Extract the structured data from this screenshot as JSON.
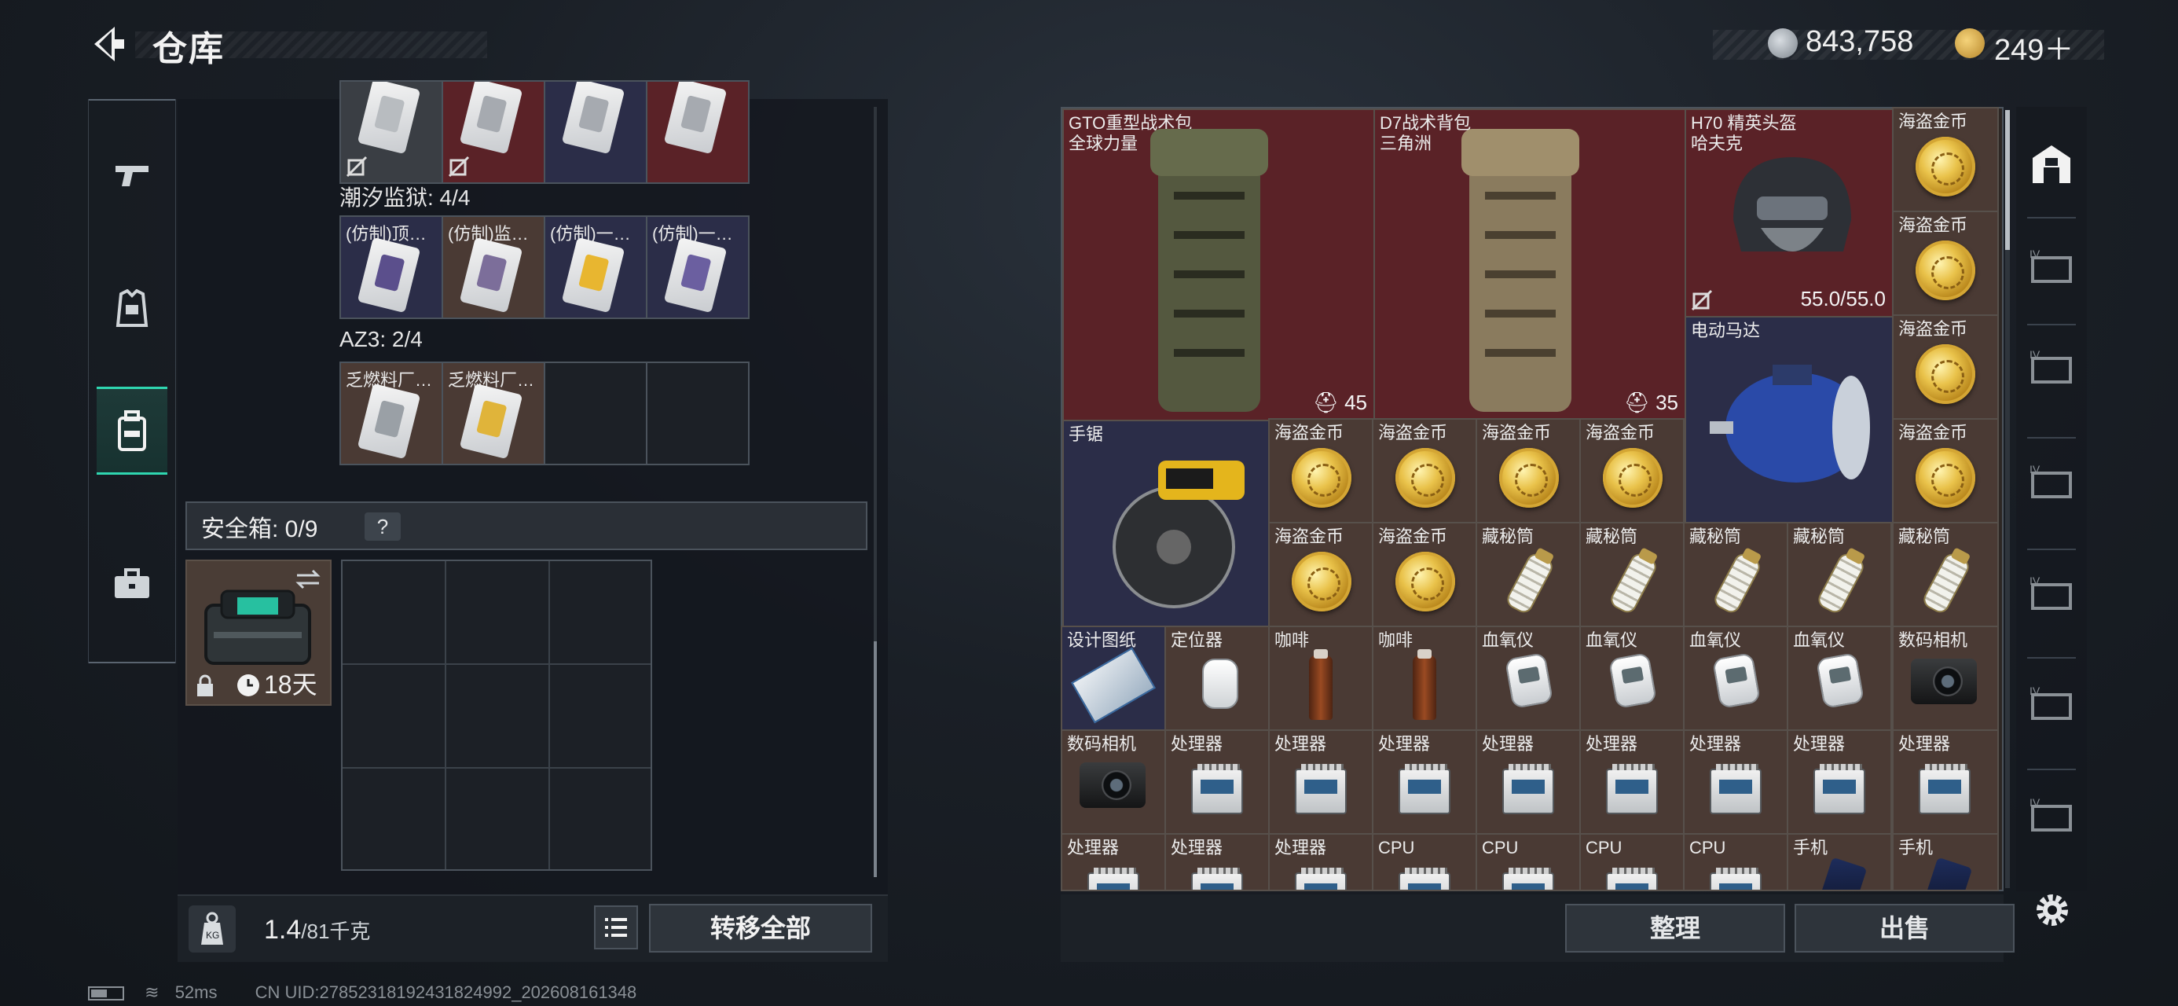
{
  "header": {
    "title": "仓库",
    "currency": [
      {
        "icon": "silver-coin-icon",
        "value": "843,758"
      },
      {
        "icon": "gold-triangle-coin-icon",
        "value": "249＋"
      }
    ]
  },
  "categories": [
    {
      "name": "weapons",
      "icon": "gun-icon"
    },
    {
      "name": "armor",
      "icon": "vest-icon"
    },
    {
      "name": "backpack",
      "icon": "backpack-icon",
      "active": true
    },
    {
      "name": "briefcase",
      "icon": "briefcase-icon"
    }
  ],
  "left": {
    "groups": [
      {
        "title": "",
        "cells": [
          {
            "label": "",
            "color": "gray",
            "locked": true
          },
          {
            "label": "",
            "color": "red",
            "locked": true
          },
          {
            "label": "",
            "color": "blue"
          },
          {
            "label": "",
            "color": "red"
          }
        ]
      },
      {
        "title": "潮汐监狱: 4/4",
        "cells": [
          {
            "label": "(仿制)顶…",
            "color": "blue"
          },
          {
            "label": "(仿制)监…",
            "color": "brown"
          },
          {
            "label": "(仿制)一…",
            "color": "blue"
          },
          {
            "label": "(仿制)一…",
            "color": "blue"
          }
        ]
      },
      {
        "title": "AZ3: 2/4",
        "cells": [
          {
            "label": "乏燃料厂…",
            "color": "brown"
          },
          {
            "label": "乏燃料厂…",
            "color": "brown"
          },
          {
            "label": "",
            "color": "empty"
          },
          {
            "label": "",
            "color": "empty"
          }
        ]
      }
    ],
    "safe_box": {
      "label": "安全箱: 0/9",
      "help": "?",
      "timer": "18天"
    },
    "weight": {
      "current": "1.4",
      "max": "/81千克"
    },
    "transfer_all": "转移全部"
  },
  "stash": {
    "items": [
      {
        "name": "GTO重型战术包",
        "sub": "全球力量",
        "stat": "45"
      },
      {
        "name": "D7战术背包",
        "sub": "三角洲",
        "stat": "35"
      },
      {
        "name": "H70 精英头盔",
        "sub": "哈夫克",
        "stat": "55.0/55.0"
      },
      {
        "name": "电动马达"
      },
      {
        "name": "手锯"
      },
      {
        "name": "设计图纸"
      },
      {
        "name": "定位器"
      }
    ],
    "coin_label": "海盗金币",
    "tube_label": "藏秘筒",
    "coffee_label": "咖啡",
    "oxi_label": "血氧仪",
    "camera_label": "数码相机",
    "proc_label": "处理器",
    "cpu_label": "CPU",
    "phone_label": "手机",
    "sort": "整理",
    "sell": "出售"
  },
  "status_bar": {
    "ping": "52ms",
    "uid": "CN UID:2785231819243182499​2_202608161348"
  }
}
